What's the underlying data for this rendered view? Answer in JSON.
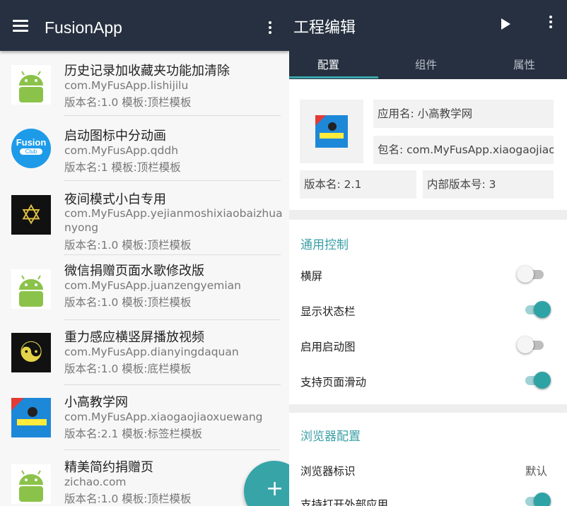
{
  "left": {
    "app_title": "FusionApp",
    "colors": {
      "appbar": "#263040",
      "fab": "#37a4a8"
    },
    "projects": [
      {
        "name": "历史记录加收藏夹功能加清除",
        "package": "com.MyFusApp.lishijilu",
        "meta": "版本名:1.0  模板:顶栏模板",
        "icon": "android-icon"
      },
      {
        "name": "启动图标中分动画",
        "package": "com.MyFusApp.qddh",
        "meta": "版本名:1  模板:顶栏模板",
        "icon": "fusion-club-icon",
        "icon_text": "Fusion",
        "icon_subtext": "Club"
      },
      {
        "name": "夜间模式小白专用",
        "package": "com.MyFusApp.yejianmoshixiaobaizhuanyong",
        "meta": "版本名:1.0  模板:顶栏模板",
        "icon": "star-emblem-icon",
        "icon_glyph": "✡"
      },
      {
        "name": "微信捐赠页面水歌修改版",
        "package": "com.MyFusApp.juanzengyemian",
        "meta": "版本名:1.0  模板:顶栏模板",
        "icon": "android-icon"
      },
      {
        "name": "重力感应横竖屏播放视频",
        "package": "com.MyFusApp.dianyingdaquan",
        "meta": "版本名:1.0  模板:底栏模板",
        "icon": "bagua-icon",
        "icon_glyph": "☯"
      },
      {
        "name": "小高教学网",
        "package": "com.MyFusApp.xiaogaojiaoxuewang",
        "meta": "版本名:2.1  模板:标签栏模板",
        "icon": "xiaogao-logo-icon"
      },
      {
        "name": "精美简约捐赠页",
        "package": "zichao.com",
        "meta": "版本名:1.0  模板:顶栏模板",
        "icon": "android-icon"
      }
    ],
    "fab_symbol": "+"
  },
  "right": {
    "title": "工程编辑",
    "tabs": [
      {
        "label": "配置",
        "active": true
      },
      {
        "label": "组件",
        "active": false
      },
      {
        "label": "属性",
        "active": false
      }
    ],
    "config": {
      "app_name": "应用名: 小高教学网",
      "package": "包名: com.MyFusApp.xiaogaojiaoxuewang",
      "version_name": "版本名: 2.1",
      "version_code": "内部版本号: 3"
    },
    "general": {
      "title": "通用控制",
      "rows": [
        {
          "label": "横屏",
          "on": false
        },
        {
          "label": "显示状态栏",
          "on": true
        },
        {
          "label": "启用启动图",
          "on": false
        },
        {
          "label": "支持页面滑动",
          "on": true
        }
      ]
    },
    "browser": {
      "title": "浏览器配置",
      "ua_label": "浏览器标识",
      "ua_value": "默认",
      "external_label": "支持打开外部应用",
      "external_on": true
    },
    "colors": {
      "accent": "#3aa6aa"
    }
  }
}
